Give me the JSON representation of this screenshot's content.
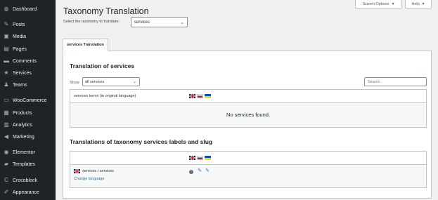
{
  "sidebar": {
    "items": [
      {
        "label": "Dashboard",
        "icon": "dashboard-icon",
        "glyph": "◍"
      },
      {
        "label": "Posts",
        "icon": "pin-icon",
        "glyph": "✎"
      },
      {
        "label": "Media",
        "icon": "media-icon",
        "glyph": "▣"
      },
      {
        "label": "Pages",
        "icon": "pages-icon",
        "glyph": "▤"
      },
      {
        "label": "Comments",
        "icon": "comments-icon",
        "glyph": "▬"
      },
      {
        "label": "Services",
        "icon": "services-star-icon",
        "glyph": "★"
      },
      {
        "label": "Teams",
        "icon": "teams-icon",
        "glyph": "♟"
      },
      {
        "label": "WooCommerce",
        "icon": "woocommerce-icon",
        "glyph": "▭"
      },
      {
        "label": "Products",
        "icon": "products-icon",
        "glyph": "▦"
      },
      {
        "label": "Analytics",
        "icon": "analytics-icon",
        "glyph": "▥"
      },
      {
        "label": "Marketing",
        "icon": "marketing-icon",
        "glyph": "◀"
      },
      {
        "label": "Elementor",
        "icon": "elementor-icon",
        "glyph": "◉"
      },
      {
        "label": "Templates",
        "icon": "templates-icon",
        "glyph": "▰"
      },
      {
        "label": "Crocoblock",
        "icon": "crocoblock-icon",
        "glyph": "C"
      },
      {
        "label": "Appearance",
        "icon": "appearance-icon",
        "glyph": "✐"
      }
    ]
  },
  "header": {
    "title": "Taxonomy Translation",
    "select_label": "Select the taxonomy to translate:",
    "select_value": "services",
    "screen_options": "Screen Options",
    "help": "Help"
  },
  "tab": {
    "label": "services Translation"
  },
  "translations": {
    "heading": "Translation of services",
    "show_label": "Show",
    "show_value": "all services",
    "search_placeholder": "Search",
    "col_header": "services terms (in original language)",
    "empty_message": "No services found."
  },
  "labels_section": {
    "heading": "Translations of taxonomy services labels and slug",
    "row_name": "services / services",
    "change_language": "Change language"
  },
  "colors": {
    "sidebar_bg": "#1d2327",
    "link": "#2271b1",
    "page_bg": "#f0f0f1"
  }
}
